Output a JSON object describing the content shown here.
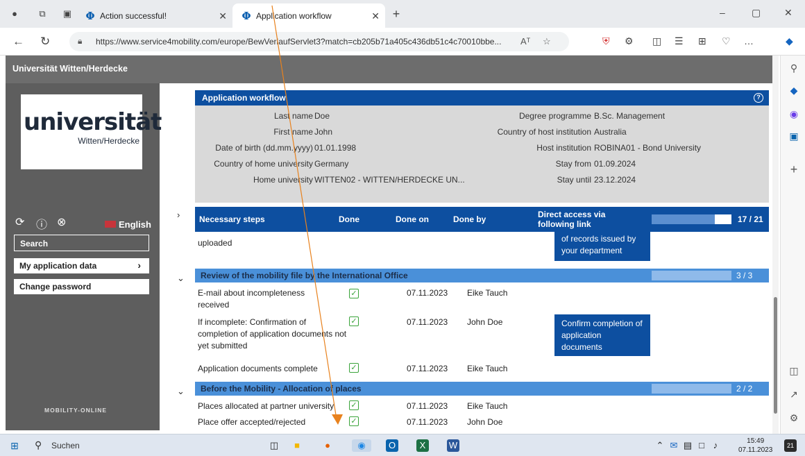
{
  "browser": {
    "tabs": [
      {
        "title": "Action successful!"
      },
      {
        "title": "Application workflow"
      }
    ],
    "new_tab": "+",
    "url": "https://www.service4mobility.com/europe/BewVerlaufServlet3?match=cb205b71a405c436db51c4c70010bbe...",
    "reader_icon": "Aᵀ",
    "minimize": "–",
    "maximize": "▢",
    "close": "✕",
    "more": "…"
  },
  "site": {
    "header": "Universität Witten/Herdecke",
    "logo_main": "universität",
    "logo_sub": "Witten/Herdecke",
    "language": "English",
    "nav": {
      "search": "Search",
      "my_application": "My application data",
      "change_password": "Change password"
    },
    "footer_logo": "MOBILITY-ONLINE"
  },
  "workflow": {
    "title": "Application workflow",
    "fields_left": [
      {
        "label": "Last name",
        "value": "Doe"
      },
      {
        "label": "First name",
        "value": "John"
      },
      {
        "label": "Date of birth (dd.mm.yyyy)",
        "value": "01.01.1998"
      },
      {
        "label": "Country of home university",
        "value": "Germany"
      },
      {
        "label": "Home university",
        "value": "WITTEN02 - WITTEN/HERDECKE UN..."
      }
    ],
    "fields_right": [
      {
        "label": "Degree programme",
        "value": "B.Sc. Management"
      },
      {
        "label": "Country of host institution",
        "value": "Australia"
      },
      {
        "label": "Host institution",
        "value": "ROBINA01 - Bond University"
      },
      {
        "label": "Stay from",
        "value": "01.09.2024"
      },
      {
        "label": "Stay until",
        "value": "23.12.2024"
      }
    ]
  },
  "steps": {
    "headers": {
      "necessary": "Necessary steps",
      "done": "Done",
      "done_on": "Done on",
      "done_by": "Done by",
      "direct": "Direct access via following link"
    },
    "total": "17 / 21",
    "total_fraction": 0.81,
    "partial_row": "uploaded",
    "partial_link": "of records issued by your department",
    "sections": [
      {
        "title": "Review of the mobility file by the International Office",
        "count": "3 / 3",
        "rows": [
          {
            "step": "E-mail about incompleteness received",
            "date": "07.11.2023",
            "by": "Eike Tauch",
            "link": ""
          },
          {
            "step": "If incomplete: Confirmation of completion of application documents not yet submitted",
            "date": "07.11.2023",
            "by": "John Doe",
            "link": "Confirm completion of application documents"
          },
          {
            "step": "Application documents complete",
            "date": "07.11.2023",
            "by": "Eike Tauch",
            "link": ""
          }
        ]
      },
      {
        "title": "Before the Mobility - Allocation of places",
        "count": "2 / 2",
        "rows": [
          {
            "step": "Places allocated at partner university",
            "date": "07.11.2023",
            "by": "Eike Tauch",
            "link": ""
          },
          {
            "step": "Place offer accepted/rejected",
            "date": "07.11.2023",
            "by": "John Doe",
            "link": ""
          }
        ]
      }
    ]
  },
  "taskbar": {
    "search": "Suchen",
    "time": "15:49",
    "date": "07.11.2023",
    "notifications": "21"
  },
  "colors": {
    "primary_blue": "#0d4fa0",
    "section_blue": "#4a90d9",
    "arrow": "#e8821e"
  }
}
